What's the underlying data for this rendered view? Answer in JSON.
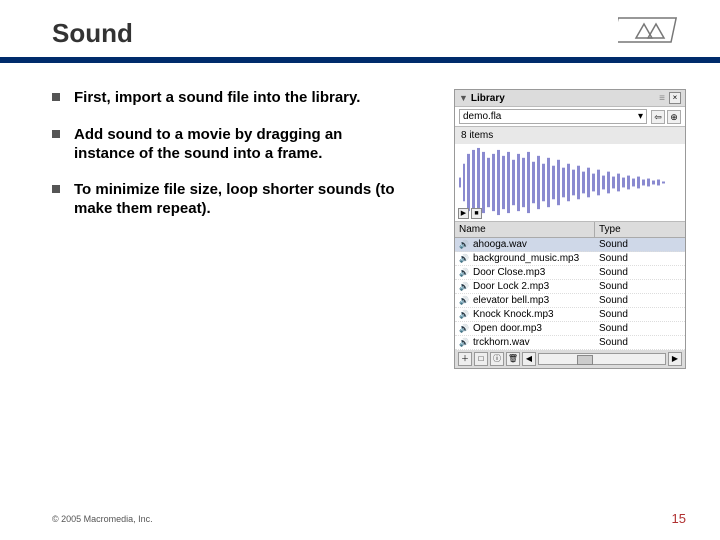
{
  "title": "Sound",
  "bullets": [
    "First, import a sound file into the library.",
    "Add sound to a movie by dragging an instance of the sound into a frame.",
    "To minimize file size, loop shorter sounds (to make them repeat)."
  ],
  "library_panel": {
    "header": "Library",
    "close": "×",
    "file_selected": "demo.fla",
    "dropdown_caret": "▾",
    "nav_prev": "⇦",
    "nav_pin": "⊕",
    "item_count": "8 items",
    "waveform_play": "▶",
    "waveform_stop": "■",
    "col_name": "Name",
    "col_type": "Type",
    "items": [
      {
        "name": "ahooga.wav",
        "type": "Sound",
        "selected": true
      },
      {
        "name": "background_music.mp3",
        "type": "Sound",
        "selected": false
      },
      {
        "name": "Door Close.mp3",
        "type": "Sound",
        "selected": false
      },
      {
        "name": "Door Lock 2.mp3",
        "type": "Sound",
        "selected": false
      },
      {
        "name": "elevator bell.mp3",
        "type": "Sound",
        "selected": false
      },
      {
        "name": "Knock Knock.mp3",
        "type": "Sound",
        "selected": false
      },
      {
        "name": "Open door.mp3",
        "type": "Sound",
        "selected": false
      },
      {
        "name": "trckhorn.wav",
        "type": "Sound",
        "selected": false
      }
    ],
    "foot_new": "＋",
    "foot_folder": "□",
    "foot_props": "ⓘ",
    "foot_del": "🗑",
    "scroll_left": "◀",
    "scroll_right": "▶"
  },
  "footer_copyright": "© 2005 Macromedia, Inc.",
  "page_number": "15"
}
